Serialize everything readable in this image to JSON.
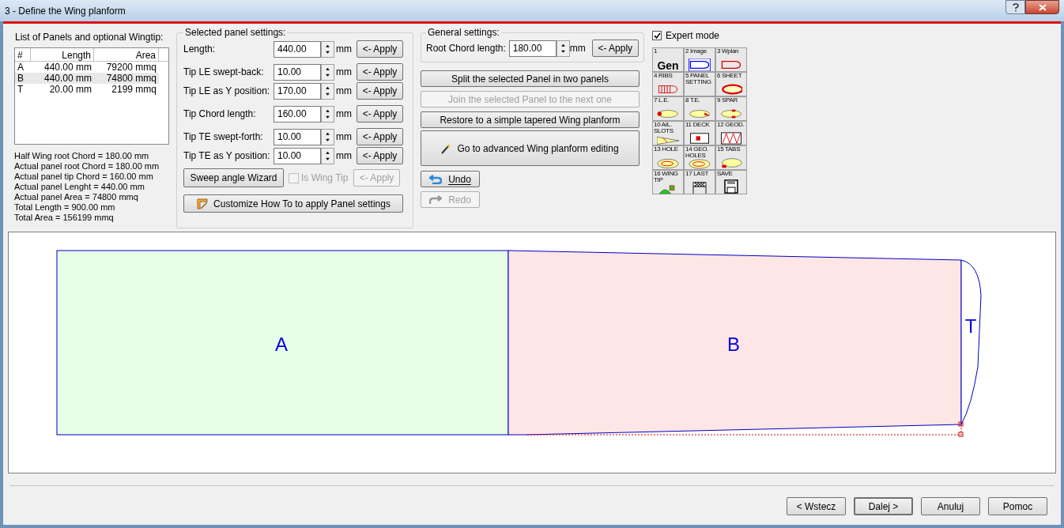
{
  "window": {
    "title": "3 - Define the Wing planform"
  },
  "panel_list": {
    "label": "List of Panels and optional Wingtip:",
    "columns": [
      "#",
      "Length",
      "Area"
    ],
    "rows": [
      {
        "cells": [
          "A",
          "440.00 mm",
          "79200 mmq"
        ],
        "selected": false
      },
      {
        "cells": [
          "B",
          "440.00 mm",
          "74800 mmq"
        ],
        "selected": true
      },
      {
        "cells": [
          "T",
          "20.00 mm",
          "2199 mmq"
        ],
        "selected": false
      }
    ]
  },
  "summary": [
    "Half Wing root Chord = 180.00 mm",
    "Actual panel root Chord = 180.00 mm",
    "Actual panel tip Chord = 160.00 mm",
    "Actual panel Lenght = 440.00 mm",
    "Actual panel Area = 74800 mmq",
    "Total Length = 900.00 mm",
    "Total Area = 156199 mmq"
  ],
  "selected_panel_settings": {
    "title": "Selected panel settings:",
    "fields": [
      {
        "label": "Length:",
        "value": "440.00",
        "unit": "mm",
        "apply": "<- Apply"
      },
      {
        "label": "Tip LE swept-back:",
        "value": "10.00",
        "unit": "mm",
        "apply": "<- Apply"
      },
      {
        "label": "Tip LE as Y position:",
        "value": "170.00",
        "unit": "mm",
        "apply": "<- Apply"
      },
      {
        "label": "Tip Chord length:",
        "value": "160.00",
        "unit": "mm",
        "apply": "<- Apply"
      },
      {
        "label": "Tip TE swept-forth:",
        "value": "10.00",
        "unit": "mm",
        "apply": "<- Apply"
      },
      {
        "label": "Tip TE as Y position:",
        "value": "10.00",
        "unit": "mm",
        "apply": "<- Apply"
      }
    ],
    "wizard_button": "Sweep angle Wizard",
    "wing_tip": {
      "label": "Is Wing Tip",
      "checked": false,
      "disabled": true
    },
    "wing_tip_apply": {
      "label": "<- Apply",
      "disabled": true
    },
    "customize_button": "Customize How To to apply Panel settings"
  },
  "general_settings": {
    "title": "General settings:",
    "label": "Root Chord length:",
    "value": "180.00",
    "unit": "mm",
    "apply": "<- Apply"
  },
  "actions": [
    {
      "label": "Split the selected Panel in two panels",
      "disabled": false,
      "kind": "plain"
    },
    {
      "label": "Join the selected Panel to the next one",
      "disabled": true,
      "kind": "plain"
    },
    {
      "label": "Restore to a simple tapered Wing planform",
      "disabled": false,
      "kind": "plain"
    },
    {
      "label": "Go to advanced Wing planform editing",
      "disabled": false,
      "kind": "wand"
    }
  ],
  "undo": {
    "label": "Undo",
    "disabled": false
  },
  "redo": {
    "label": "Redo",
    "disabled": true
  },
  "expert_mode": {
    "label": "Expert mode",
    "checked": true
  },
  "tools": [
    {
      "label": "1",
      "kind": "gen",
      "text": "Gen"
    },
    {
      "label": "2 Image",
      "kind": "image"
    },
    {
      "label": "3 Wplan",
      "kind": "wplan"
    },
    {
      "label": "4 RIBS",
      "kind": "ribs"
    },
    {
      "label": "5 PANEL SETTING",
      "kind": "none"
    },
    {
      "label": "6 SHEET",
      "kind": "sheet"
    },
    {
      "label": "7 L.E.",
      "kind": "le"
    },
    {
      "label": "8 T.E.",
      "kind": "te"
    },
    {
      "label": "9 SPAR",
      "kind": "spar"
    },
    {
      "label": "10 AIL. SLOTS",
      "kind": "ail"
    },
    {
      "label": "11 DECK",
      "kind": "deck"
    },
    {
      "label": "12 GEOD.",
      "kind": "geod"
    },
    {
      "label": "13 HOLE",
      "kind": "hole"
    },
    {
      "label": "14 GEO. HOLES",
      "kind": "hole"
    },
    {
      "label": "15 TABS",
      "kind": "tabs"
    },
    {
      "label": "16 WING TIP",
      "kind": "tip"
    },
    {
      "label": "17 LAST",
      "kind": "last"
    },
    {
      "label": "SAVE",
      "kind": "save"
    }
  ],
  "planform": {
    "panels": [
      {
        "label": "A",
        "color": "#e6ffe6"
      },
      {
        "label": "B",
        "color": "#ffe6e6"
      },
      {
        "label": "T",
        "color": "#ffffff"
      }
    ]
  },
  "footer_buttons": [
    {
      "label": "< Wstecz",
      "default": false
    },
    {
      "label": "Dalej >",
      "default": true
    },
    {
      "label": "Anuluj",
      "default": false
    },
    {
      "label": "Pomoc",
      "default": false
    }
  ]
}
